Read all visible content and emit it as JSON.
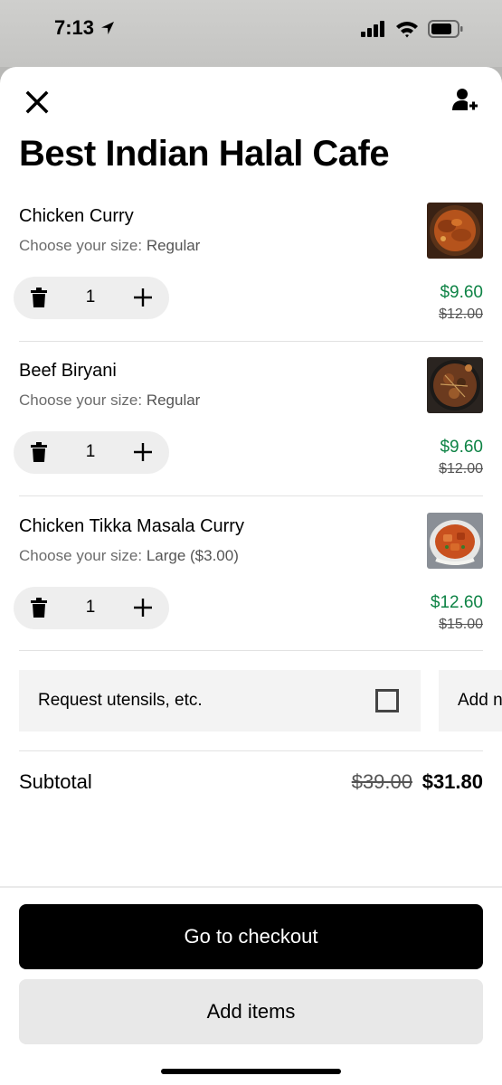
{
  "status_bar": {
    "time": "7:13"
  },
  "header": {
    "title": "Best Indian Halal Cafe"
  },
  "cart": {
    "option_label": "Choose your size:",
    "items": [
      {
        "name": "Chicken Curry",
        "option_value": "Regular",
        "quantity": "1",
        "price": "$9.60",
        "old_price": "$12.00",
        "image": "chicken-curry-photo"
      },
      {
        "name": "Beef Biryani",
        "option_value": "Regular",
        "quantity": "1",
        "price": "$9.60",
        "old_price": "$12.00",
        "image": "beef-biryani-photo"
      },
      {
        "name": "Chicken Tikka Masala Curry",
        "option_value": "Large ($3.00)",
        "quantity": "1",
        "price": "$12.60",
        "old_price": "$15.00",
        "image": "chicken-tikka-masala-photo"
      }
    ]
  },
  "extras": {
    "utensils_label": "Request utensils, etc.",
    "utensils_checked": false,
    "add_note_label": "Add n"
  },
  "subtotal": {
    "label": "Subtotal",
    "old": "$39.00",
    "new": "$31.80"
  },
  "footer": {
    "checkout_label": "Go to checkout",
    "add_items_label": "Add items"
  },
  "colors": {
    "discount_price": "#0e8345",
    "primary_button": "#000000",
    "secondary_button": "#e8e8e8"
  },
  "icons": [
    "location-arrow-icon",
    "signal-icon",
    "wifi-icon",
    "battery-icon",
    "close-icon",
    "add-person-icon",
    "trash-icon",
    "plus-icon",
    "checkbox-icon"
  ]
}
